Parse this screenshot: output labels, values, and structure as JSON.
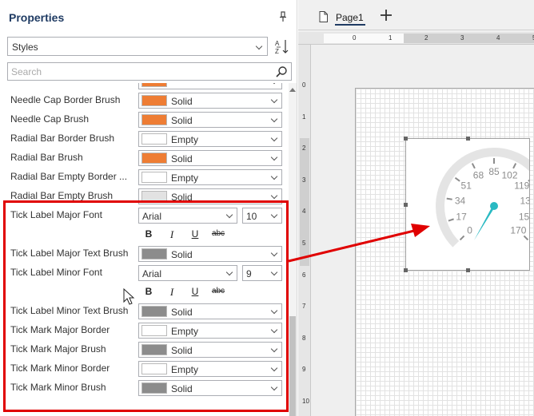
{
  "properties": {
    "title": "Properties",
    "styles_value": "Styles",
    "search_placeholder": "Search",
    "rows": [
      {
        "kind": "brush",
        "label": "",
        "value": "",
        "color": "#ee7d34",
        "partial": true
      },
      {
        "kind": "brush",
        "label": "Needle Cap Border Brush",
        "value": "Solid",
        "color": "#ee7d34"
      },
      {
        "kind": "brush",
        "label": "Needle Cap Brush",
        "value": "Solid",
        "color": "#ee7d34"
      },
      {
        "kind": "brush",
        "label": "Radial Bar Border Brush",
        "value": "Empty",
        "color": "#ffffff"
      },
      {
        "kind": "brush",
        "label": "Radial Bar Brush",
        "value": "Solid",
        "color": "#ee7d34"
      },
      {
        "kind": "brush",
        "label": "Radial Bar Empty Border ...",
        "value": "Empty",
        "color": "#ffffff"
      },
      {
        "kind": "brush",
        "label": "Radial Bar Empty Brush",
        "value": "Solid",
        "color": "#e2e2e2"
      },
      {
        "kind": "font",
        "label": "Tick Label Major Font",
        "font": "Arial",
        "size": "10"
      },
      {
        "kind": "style"
      },
      {
        "kind": "brush",
        "label": "Tick Label Major Text Brush",
        "value": "Solid",
        "color": "#8c8c8c"
      },
      {
        "kind": "font",
        "label": "Tick Label Minor Font",
        "font": "Arial",
        "size": "9"
      },
      {
        "kind": "style"
      },
      {
        "kind": "brush",
        "label": "Tick Label Minor Text Brush",
        "value": "Solid",
        "color": "#8c8c8c"
      },
      {
        "kind": "brush",
        "label": "Tick Mark Major Border",
        "value": "Empty",
        "color": "#ffffff"
      },
      {
        "kind": "brush",
        "label": "Tick Mark Major Brush",
        "value": "Solid",
        "color": "#8c8c8c"
      },
      {
        "kind": "brush",
        "label": "Tick Mark Minor Border",
        "value": "Empty",
        "color": "#ffffff"
      },
      {
        "kind": "brush",
        "label": "Tick Mark Minor Brush",
        "value": "Solid",
        "color": "#8c8c8c"
      }
    ],
    "style_buttons": {
      "bold": "B",
      "italic": "I",
      "underline": "U",
      "strike": "abc"
    }
  },
  "designer": {
    "tab_label": "Page1",
    "ruler_h": [
      "0",
      "1",
      "2",
      "3",
      "4",
      "5"
    ],
    "ruler_v": [
      "0",
      "1",
      "2",
      "3",
      "4",
      "5",
      "6",
      "7",
      "8",
      "9",
      "10"
    ],
    "gauge_ticks": [
      "0",
      "17",
      "34",
      "51",
      "68",
      "85",
      "102",
      "119",
      "136",
      "153",
      "170"
    ]
  },
  "colors": {
    "accent": "#1f3b63",
    "highlight": "#e00000",
    "needle": "#29b9c2",
    "gauge_band": "#e4e4e4"
  }
}
